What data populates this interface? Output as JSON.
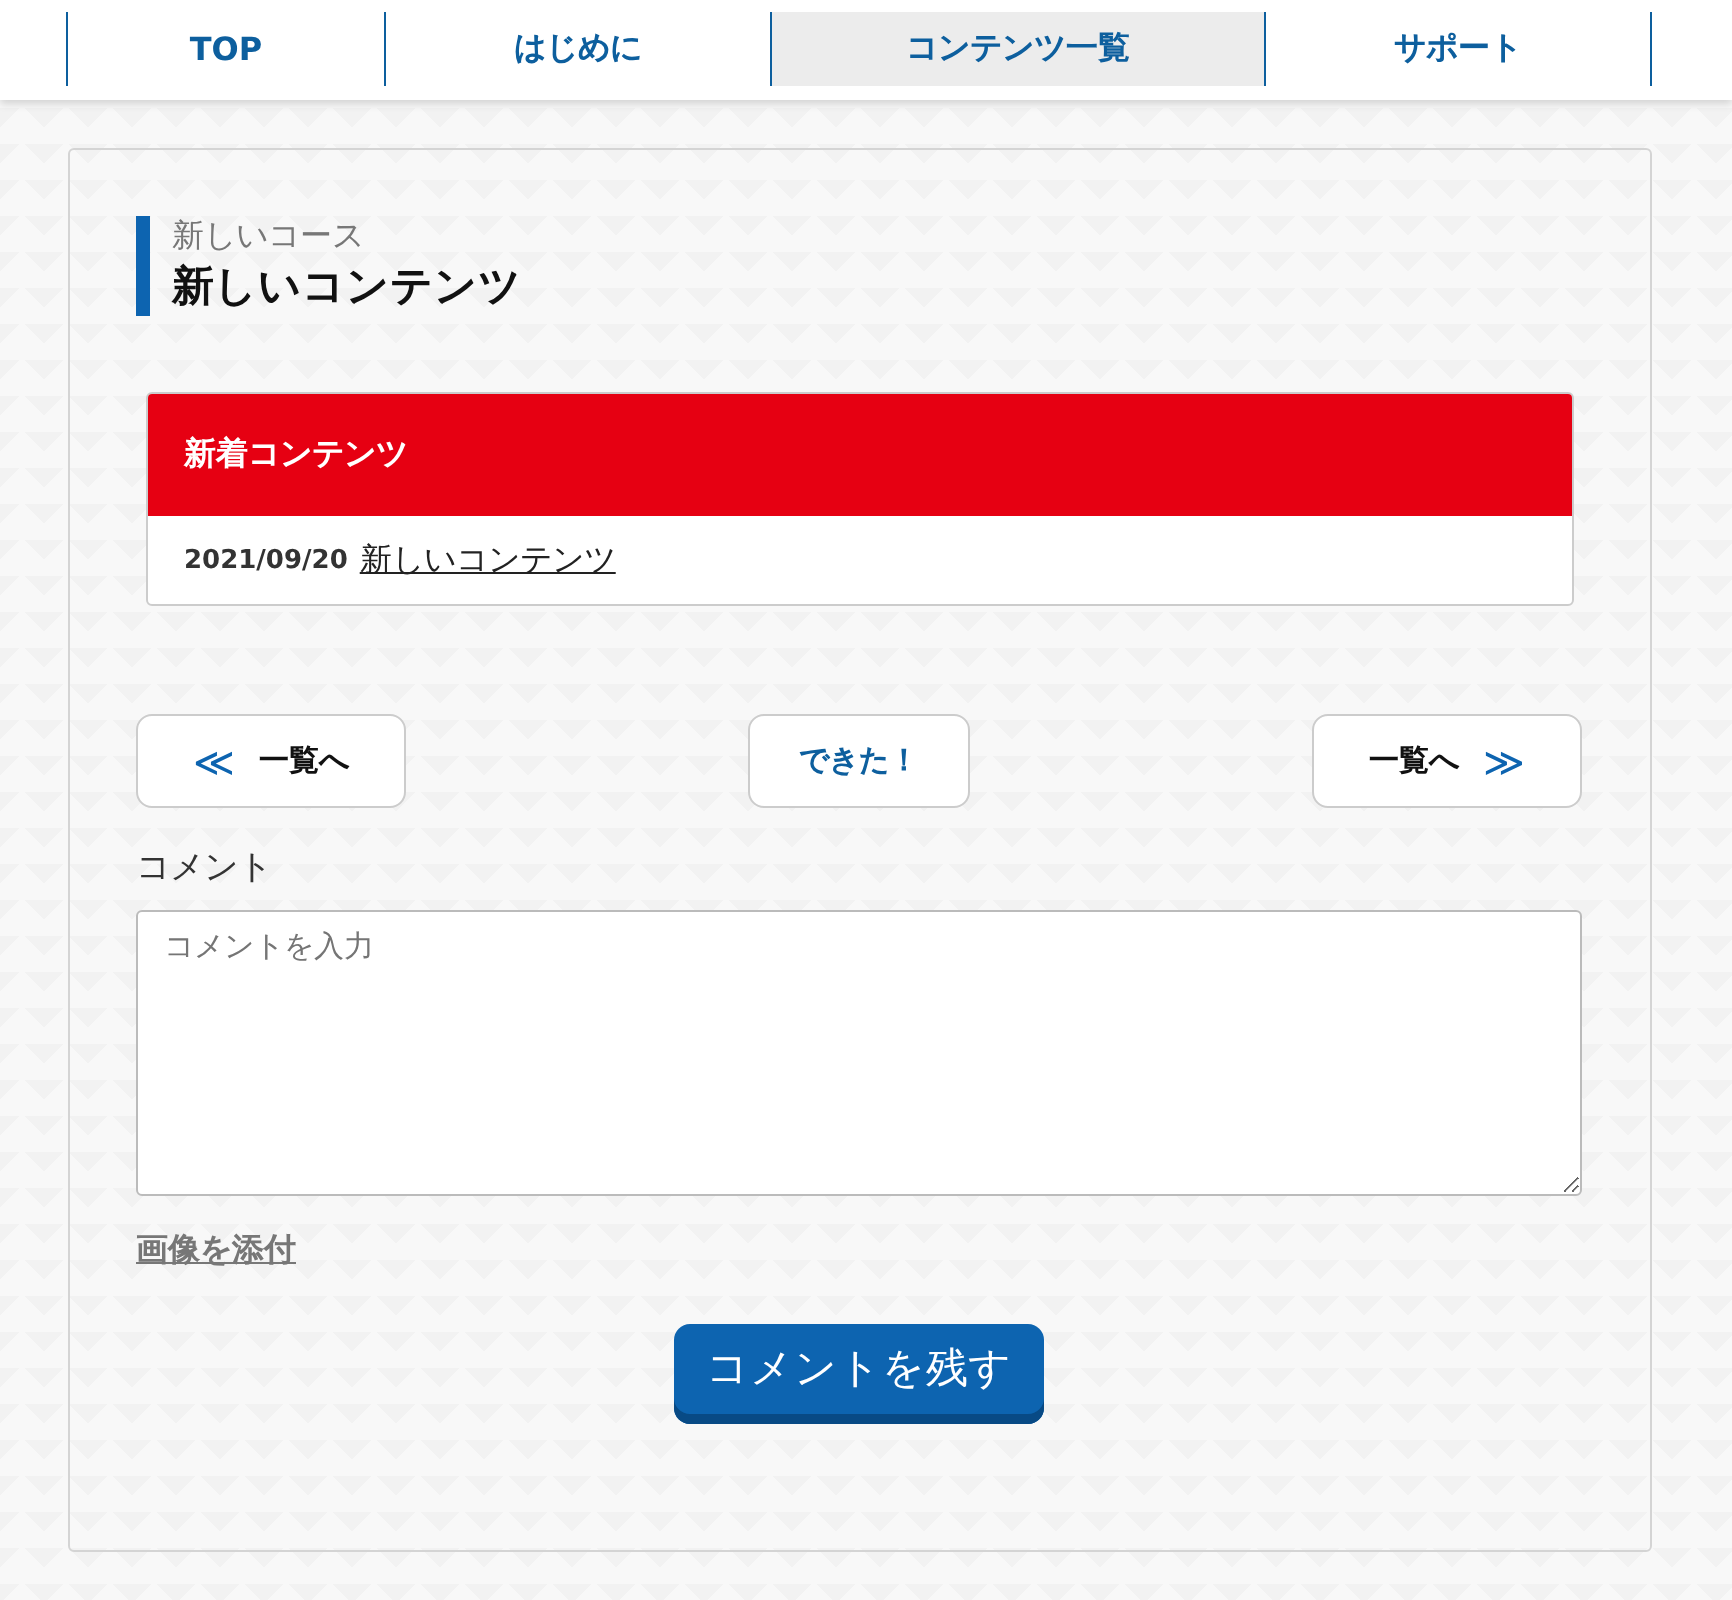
{
  "nav": {
    "tabs": [
      {
        "label": "TOP",
        "selected": false
      },
      {
        "label": "はじめに",
        "selected": false
      },
      {
        "label": "コンテンツ一覧",
        "selected": true
      },
      {
        "label": "サポート",
        "selected": false
      }
    ]
  },
  "heading": {
    "course": "新しいコース",
    "title": "新しいコンテンツ"
  },
  "news": {
    "title": "新着コンテンツ",
    "items": [
      {
        "date": "2021/09/20",
        "link": "新しいコンテンツ"
      }
    ]
  },
  "pager": {
    "prev": {
      "arrow": "≪",
      "label": "一覧へ"
    },
    "done": "できた！",
    "next": {
      "label": "一覧へ",
      "arrow": "≫"
    }
  },
  "comment": {
    "label": "コメント",
    "placeholder": "コメントを入力",
    "attach": "画像を添付",
    "submit": "コメントを残す"
  }
}
